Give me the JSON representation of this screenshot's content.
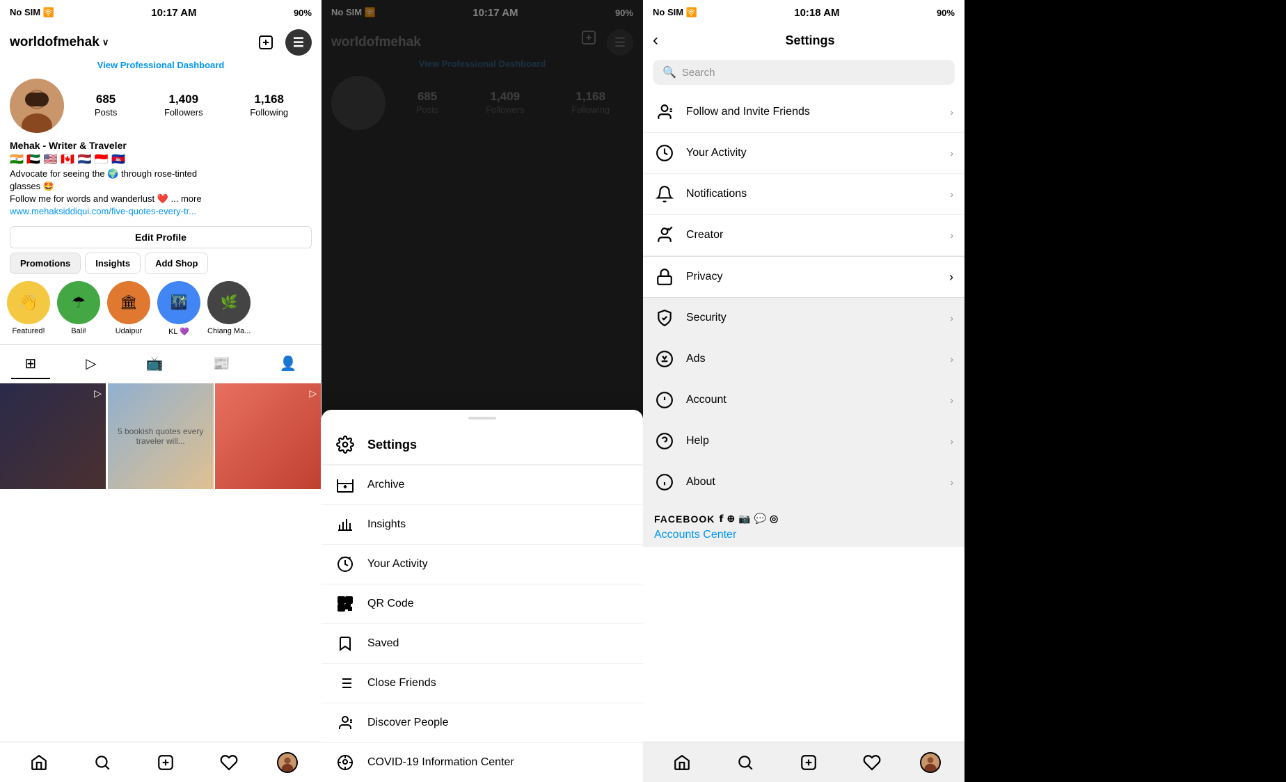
{
  "phone1": {
    "status_bar": {
      "carrier": "No SIM 🛜",
      "time": "10:17 AM",
      "battery": "90%"
    },
    "header": {
      "username": "worldofmehak",
      "plus_label": "+",
      "menu_label": "☰"
    },
    "professional_link": "View Professional Dashboard",
    "stats": [
      {
        "num": "685",
        "label": "Posts"
      },
      {
        "num": "1,409",
        "label": "Followers"
      },
      {
        "num": "1,168",
        "label": "Following"
      }
    ],
    "bio": {
      "name": "Mehak - Writer & Traveler",
      "flags": "🇮🇳 🇦🇪 🇺🇸 🇨🇦 🇳🇱 🇮🇩 🇰🇭",
      "line1": "Advocate for seeing the 🌍 through rose-tinted",
      "line2": "glasses 🤩",
      "line3": "Follow me for words and wanderlust ❤️ ... more",
      "link": "www.mehaksiddiqui.com/five-quotes-every-tr..."
    },
    "edit_profile": "Edit Profile",
    "tabs": [
      "Promotions",
      "Insights",
      "Add Shop"
    ],
    "stories": [
      {
        "label": "Featured!",
        "color": "yellow"
      },
      {
        "label": "Bali!",
        "color": "green"
      },
      {
        "label": "Udaipur",
        "color": "orange"
      },
      {
        "label": "KL 💜",
        "color": "blue"
      },
      {
        "label": "Chiang Ma...",
        "color": "dark"
      }
    ],
    "bottom_nav": {
      "home": "🏠",
      "search": "🔍",
      "add": "➕",
      "heart": "♡",
      "profile": "👤"
    }
  },
  "phone2": {
    "status_bar": {
      "carrier": "No SIM 🛜",
      "time": "10:17 AM",
      "battery": "90%"
    },
    "header": {
      "username": "worldofmehak"
    },
    "professional_link": "View Professional Dashboard",
    "menu": {
      "title": "Settings",
      "items": [
        {
          "icon": "archive",
          "label": "Archive"
        },
        {
          "icon": "insights",
          "label": "Insights"
        },
        {
          "icon": "activity",
          "label": "Your Activity"
        },
        {
          "icon": "qr",
          "label": "QR Code"
        },
        {
          "icon": "saved",
          "label": "Saved"
        },
        {
          "icon": "friends",
          "label": "Close Friends"
        },
        {
          "icon": "discover",
          "label": "Discover People"
        },
        {
          "icon": "covid",
          "label": "COVID-19 Information Center"
        }
      ]
    }
  },
  "phone3": {
    "status_bar": {
      "carrier": "No SIM 🛜",
      "time": "10:18 AM",
      "battery": "90%"
    },
    "back_label": "‹",
    "title": "Settings",
    "search_placeholder": "Search",
    "settings_items": [
      {
        "icon": "follow",
        "label": "Follow and Invite Friends"
      },
      {
        "icon": "activity",
        "label": "Your Activity"
      },
      {
        "icon": "notifications",
        "label": "Notifications"
      },
      {
        "icon": "creator",
        "label": "Creator"
      },
      {
        "icon": "privacy",
        "label": "Privacy",
        "selected": true
      },
      {
        "icon": "security",
        "label": "Security"
      },
      {
        "icon": "ads",
        "label": "Ads"
      },
      {
        "icon": "account",
        "label": "Account"
      },
      {
        "icon": "help",
        "label": "Help"
      },
      {
        "icon": "about",
        "label": "About"
      }
    ],
    "facebook_section": {
      "label": "FACEBOOK",
      "icons": "🅕 ⊕ 📸 🟢 ✉",
      "link": "Accounts Center"
    },
    "bottom_nav": {
      "home": "🏠",
      "search": "🔍",
      "add": "➕",
      "heart": "♡",
      "profile": "👤"
    }
  }
}
